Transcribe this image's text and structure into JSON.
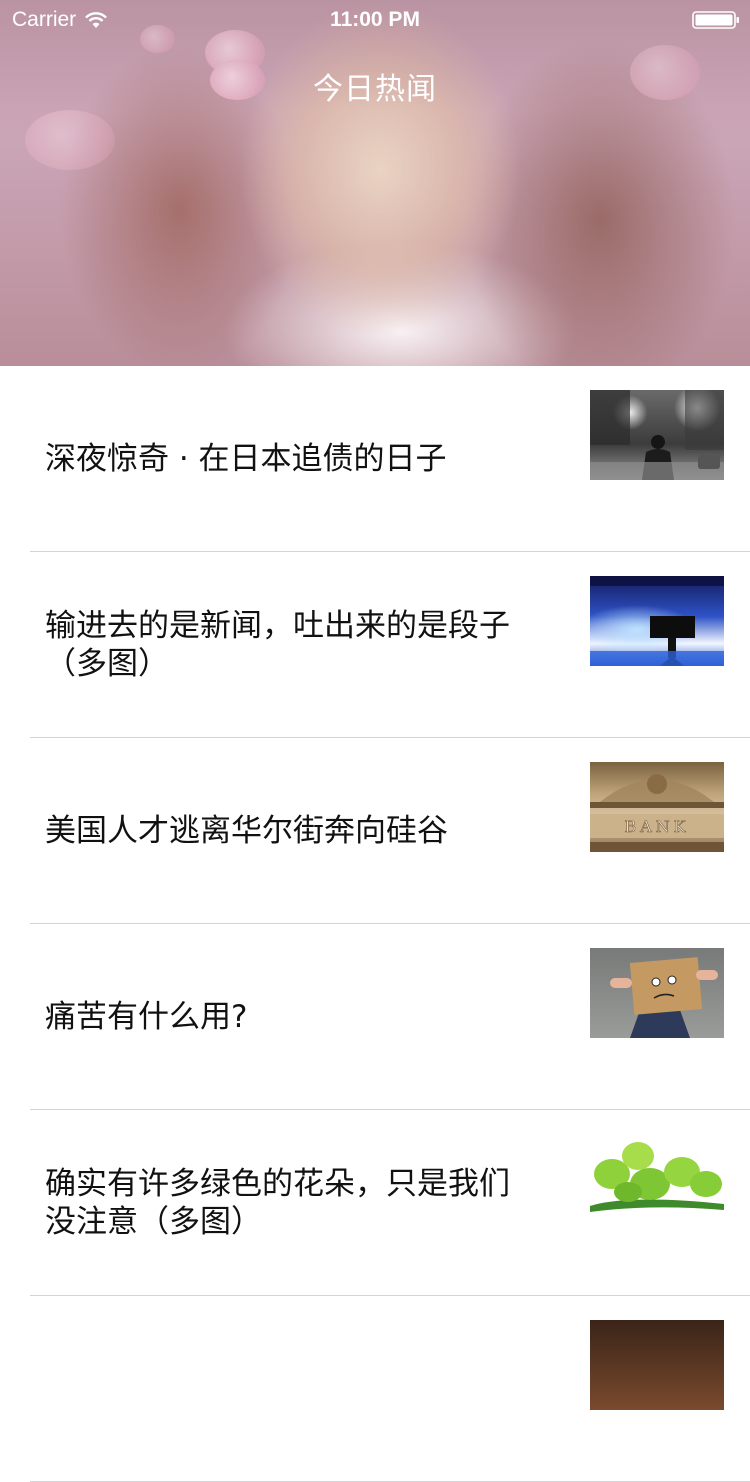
{
  "status_bar": {
    "carrier": "Carrier",
    "time": "11:00 PM"
  },
  "header": {
    "title": "今日热闻"
  },
  "news": [
    {
      "title": "深夜惊奇 · 在日本追债的日子",
      "thumbnail": "street-photo"
    },
    {
      "title": "输进去的是新闻，吐出来的是段子（多图）",
      "thumbnail": "news-studio-photo"
    },
    {
      "title": "美国人才逃离华尔街奔向硅谷",
      "thumbnail": "bank-facade-photo"
    },
    {
      "title": "痛苦有什么用?",
      "thumbnail": "box-head-photo"
    },
    {
      "title": "确实有许多绿色的花朵，只是我们没注意（多图）",
      "thumbnail": "green-hops-photo"
    },
    {
      "title": "",
      "thumbnail": "food-photo"
    }
  ]
}
